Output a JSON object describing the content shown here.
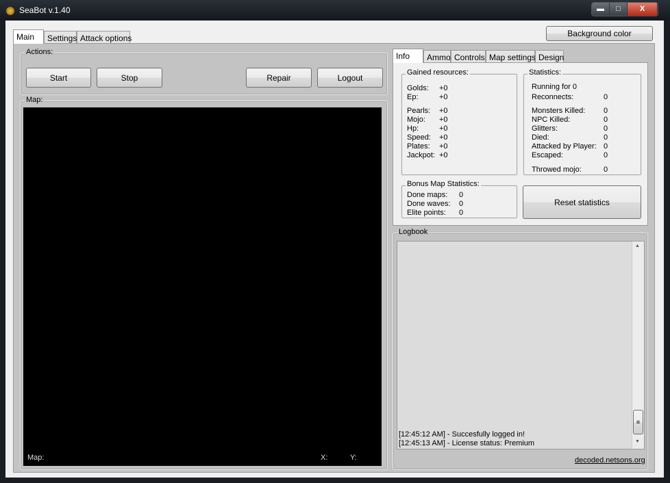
{
  "window": {
    "title": "SeaBot v.1.40",
    "minimize": "▬",
    "maximize": "□",
    "close": "X"
  },
  "main_tabs": [
    {
      "label": "Main"
    },
    {
      "label": "Settings"
    },
    {
      "label": "Attack options"
    }
  ],
  "background_color_button": "Background color",
  "actions": {
    "label": "Actions:",
    "start": "Start",
    "stop": "Stop",
    "repair": "Repair",
    "logout": "Logout"
  },
  "map": {
    "label": "Map:",
    "overlay_label": "Map:",
    "x_label": "X:",
    "y_label": "Y:"
  },
  "right_tabs": [
    {
      "label": "Info"
    },
    {
      "label": "Ammo"
    },
    {
      "label": "Controls"
    },
    {
      "label": "Map settings"
    },
    {
      "label": "Design"
    }
  ],
  "gained": {
    "label": "Gained resources:",
    "items": [
      {
        "label": "Golds:",
        "value": "+0"
      },
      {
        "label": "Ep:",
        "value": "+0"
      },
      {
        "label": "Pearls:",
        "value": "+0"
      },
      {
        "label": "Mojo:",
        "value": "+0"
      },
      {
        "label": "Hp:",
        "value": "+0"
      },
      {
        "label": "Speed:",
        "value": "+0"
      },
      {
        "label": "Plates:",
        "value": "+0"
      },
      {
        "label": "Jackpot:",
        "value": "+0"
      }
    ]
  },
  "statistics": {
    "label": "Statistics:",
    "running": "Running for 0",
    "items": [
      {
        "label": "Reconnects:",
        "value": "0"
      },
      {
        "label": "Monsters Killed:",
        "value": "0"
      },
      {
        "label": "NPC Killed:",
        "value": "0"
      },
      {
        "label": "Glitters:",
        "value": "0"
      },
      {
        "label": "Died:",
        "value": "0"
      },
      {
        "label": "Attacked by Player:",
        "value": "0"
      },
      {
        "label": "Escaped:",
        "value": "0"
      },
      {
        "label": "Throwed mojo:",
        "value": "0"
      }
    ]
  },
  "bonus": {
    "label": "Bonus Map Statistics:",
    "items": [
      {
        "label": "Done maps:",
        "value": "0"
      },
      {
        "label": "Done waves:",
        "value": "0"
      },
      {
        "label": "Elite points:",
        "value": "0"
      }
    ]
  },
  "reset_button": "Reset statistics",
  "logbook": {
    "label": "Logbook",
    "lines": [
      "[12:45:12 AM] - Succesfully logged in!",
      "[12:45:13 AM] - License status: Premium"
    ]
  },
  "link": "decoded.netsons.org"
}
